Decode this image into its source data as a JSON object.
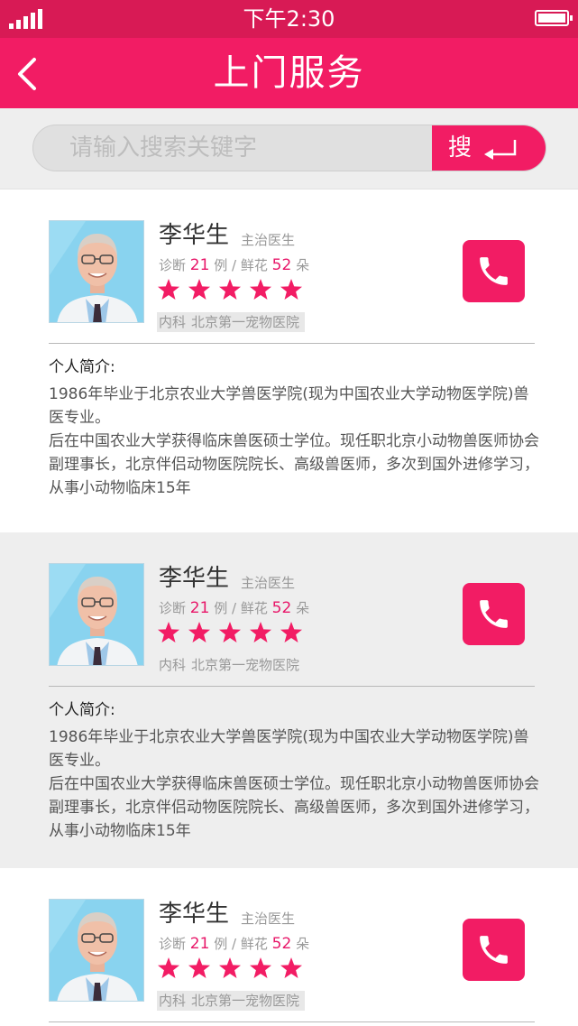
{
  "status_bar": {
    "time": "下午2:30"
  },
  "header": {
    "title": "上门服务"
  },
  "search": {
    "placeholder": "请输入搜索关键字",
    "button_label": "搜"
  },
  "doctors": [
    {
      "name": "李华生",
      "title": "主治医生",
      "stats": {
        "diagnosis_prefix": "诊断",
        "diagnosis_count": "21",
        "diagnosis_unit": "例",
        "separator": "/",
        "flowers_prefix": "鲜花",
        "flowers_count": "52",
        "flowers_unit": "朵"
      },
      "rating": 5,
      "department": "内科",
      "hospital": "北京第一宠物医院",
      "intro_label": "个人简介:",
      "intro_lines": [
        "1986年毕业于北京农业大学兽医学院(现为中国农业大学动物医学院)兽医专业。",
        "后在中国农业大学获得临床兽医硕士学位。现任职北京小动物兽医师协会副理事长，北京伴侣动物医院院长、高级兽医师，多次到国外进修学习，从事小动物临床15年"
      ]
    },
    {
      "name": "李华生",
      "title": "主治医生",
      "stats": {
        "diagnosis_prefix": "诊断",
        "diagnosis_count": "21",
        "diagnosis_unit": "例",
        "separator": "/",
        "flowers_prefix": "鲜花",
        "flowers_count": "52",
        "flowers_unit": "朵"
      },
      "rating": 5,
      "department": "内科",
      "hospital": "北京第一宠物医院",
      "intro_label": "个人简介:",
      "intro_lines": [
        "1986年毕业于北京农业大学兽医学院(现为中国农业大学动物医学院)兽医专业。",
        "后在中国农业大学获得临床兽医硕士学位。现任职北京小动物兽医师协会副理事长，北京伴侣动物医院院长、高级兽医师，多次到国外进修学习，从事小动物临床15年"
      ]
    },
    {
      "name": "李华生",
      "title": "主治医生",
      "stats": {
        "diagnosis_prefix": "诊断",
        "diagnosis_count": "21",
        "diagnosis_unit": "例",
        "separator": "/",
        "flowers_prefix": "鲜花",
        "flowers_count": "52",
        "flowers_unit": "朵"
      },
      "rating": 5,
      "department": "内科",
      "hospital": "北京第一宠物医院"
    }
  ],
  "colors": {
    "status_bar": "#d81a55",
    "accent": "#f21c64",
    "highlight_number": "#e8186a"
  },
  "icons": {
    "back": "chevron-left-icon",
    "search": "enter-arrow-icon",
    "call": "phone-icon",
    "rating": "star-icon"
  }
}
